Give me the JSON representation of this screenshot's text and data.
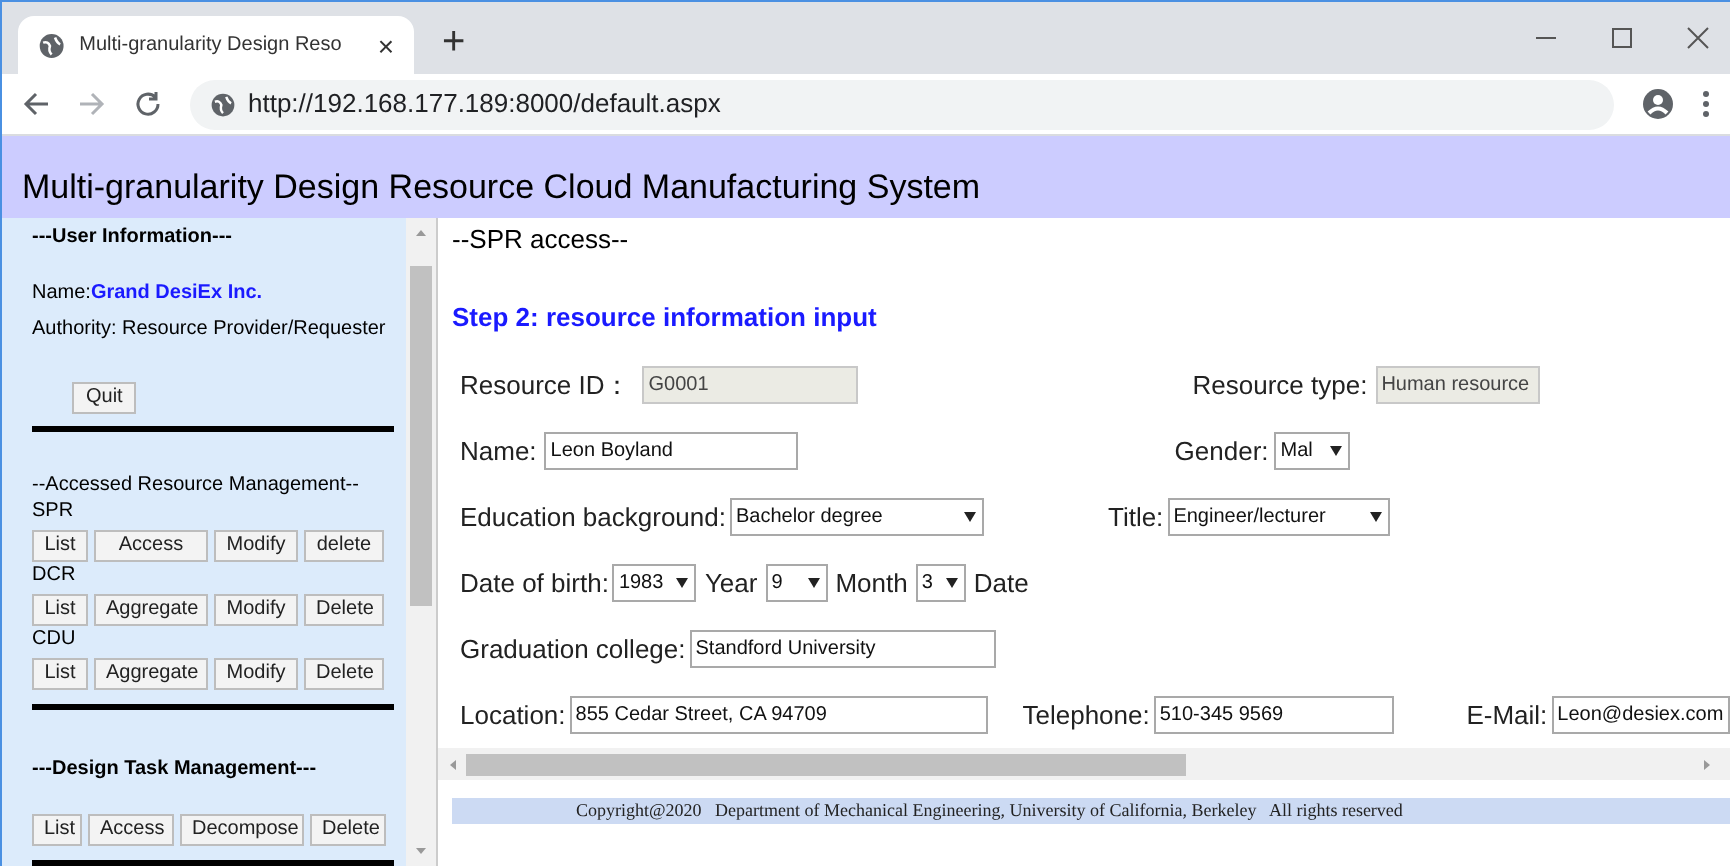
{
  "browser": {
    "tab_title": "Multi-granularity Design Reso",
    "tab_close": "×",
    "new_tab": "+",
    "url": "http://192.168.177.189:8000/default.aspx"
  },
  "page_title": "Multi-granularity Design Resource Cloud Manufacturing System",
  "sidebar": {
    "user_heading": "---User Information---",
    "name_label": "Name:",
    "name_value": "Grand DesiEx Inc.",
    "authority": "Authority: Resource Provider/Requester",
    "quit": "Quit",
    "resource_heading": "--Accessed Resource Management--",
    "groups": [
      {
        "label": "SPR",
        "buttons": [
          "List",
          "Access",
          "Modify",
          "delete"
        ]
      },
      {
        "label": "DCR",
        "buttons": [
          "List",
          "Aggregate",
          "Modify",
          "Delete"
        ]
      },
      {
        "label": "CDU",
        "buttons": [
          "List",
          "Aggregate",
          "Modify",
          "Delete"
        ]
      }
    ],
    "task_heading": "---Design Task Management---",
    "task_buttons": [
      "List",
      "Access",
      "Decompose",
      "Delete"
    ]
  },
  "main": {
    "heading": "--SPR access--",
    "step": "Step 2: resource information input",
    "lines": [
      {
        "items": [
          {
            "kind": "label",
            "text": "Resource ID："
          },
          {
            "kind": "text",
            "value": "G0001",
            "disabled": true
          },
          {
            "kind": "label",
            "text": "Resource type:"
          },
          {
            "kind": "text",
            "value": "Human resource",
            "disabled": true
          }
        ]
      },
      {
        "items": [
          {
            "kind": "label",
            "text": "Name:"
          },
          {
            "kind": "text",
            "value": "Leon Boyland",
            "disabled": false
          },
          {
            "kind": "label",
            "text": "Gender:"
          },
          {
            "kind": "select",
            "value": "Mal"
          }
        ]
      },
      {
        "items": [
          {
            "kind": "label",
            "text": "Education background:"
          },
          {
            "kind": "select",
            "value": "Bachelor degree"
          },
          {
            "kind": "label",
            "text": "Title:"
          },
          {
            "kind": "select",
            "value": "Engineer/lecturer"
          }
        ]
      },
      {
        "items": [
          {
            "kind": "label",
            "text": "Date of birth:"
          },
          {
            "kind": "select",
            "value": "1983"
          },
          {
            "kind": "label",
            "text": "Year"
          },
          {
            "kind": "select",
            "value": "9"
          },
          {
            "kind": "label",
            "text": "Month"
          },
          {
            "kind": "select",
            "value": "3"
          },
          {
            "kind": "label",
            "text": "Date"
          }
        ]
      },
      {
        "items": [
          {
            "kind": "label",
            "text": "Graduation college:"
          },
          {
            "kind": "text",
            "value": "Standford University",
            "disabled": false
          }
        ]
      },
      {
        "items": [
          {
            "kind": "label",
            "text": "Location:"
          },
          {
            "kind": "text",
            "value": "855 Cedar Street, CA 94709",
            "disabled": false
          },
          {
            "kind": "label",
            "text": "Telephone:"
          },
          {
            "kind": "text",
            "value": "510-345 9569",
            "disabled": false
          },
          {
            "kind": "label",
            "text": "E-Mail:"
          },
          {
            "kind": "text",
            "value": "Leon@desiex.com",
            "disabled": false
          }
        ]
      }
    ]
  },
  "footer": "Copyright@2020   Department of Mechanical Engineering, University of California, Berkeley   All rights reserved"
}
